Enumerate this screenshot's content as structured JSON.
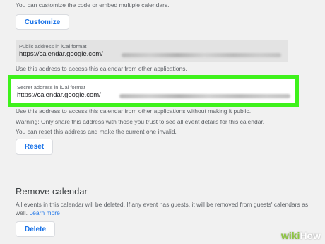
{
  "top": {
    "intro_text": "You can customize the code or embed multiple calendars.",
    "customize_label": "Customize"
  },
  "public_ical": {
    "label": "Public address in iCal format",
    "url_prefix": "https://calendar.google.com/",
    "help": "Use this address to access this calendar from other applications."
  },
  "secret_ical": {
    "label": "Secret address in iCal format",
    "url_prefix": "https://calendar.google.com/",
    "help": "Use this address to access this calendar from other applications without making it public.",
    "warning": "Warning: Only share this address with those you trust to see all event details for this calendar.",
    "reset_info": "You can reset this address and make the current one invalid.",
    "reset_label": "Reset",
    "highlight_color": "#3ef21b"
  },
  "remove": {
    "title": "Remove calendar",
    "description": "All events in this calendar will be deleted. If any event has guests, it will be removed from guests' calendars as",
    "description_line2": "well.",
    "learn_more": "Learn more",
    "delete_label": "Delete"
  },
  "watermark": {
    "wiki": "wiki",
    "how": "How"
  },
  "colors": {
    "accent": "#1a73e8",
    "background": "#f1f1f1",
    "field": "#e3e3e3"
  }
}
